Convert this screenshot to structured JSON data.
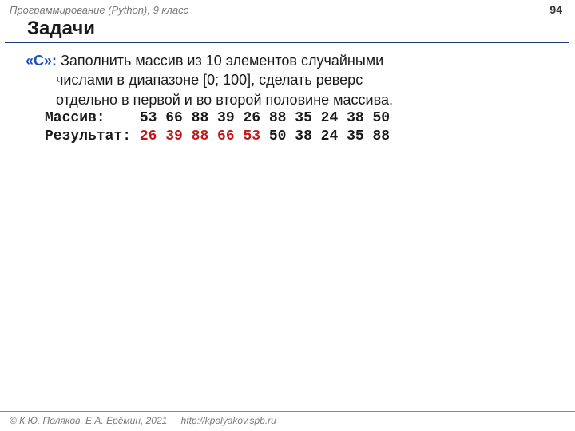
{
  "header": {
    "course": "Программирование (Python), 9 класс",
    "page": "94"
  },
  "title": "Задачи",
  "task": {
    "label": "«C»:",
    "line1": " Заполнить массив из 10 элементов случайными",
    "line2": "числами в диапазоне [0; 100], сделать реверс",
    "line3": "отдельно в первой и во второй половине массива."
  },
  "array": {
    "label": "Массив:   ",
    "values": " 53 66 88 39 26 88 35 24 38 50"
  },
  "result": {
    "label": "Результат:",
    "red": " 26 39 88 66 53",
    "rest": " 50 38 24 35 88"
  },
  "footer": {
    "copyright": "© К.Ю. Поляков, Е.А. Ерёмин, 2021",
    "url": "http://kpolyakov.spb.ru"
  }
}
